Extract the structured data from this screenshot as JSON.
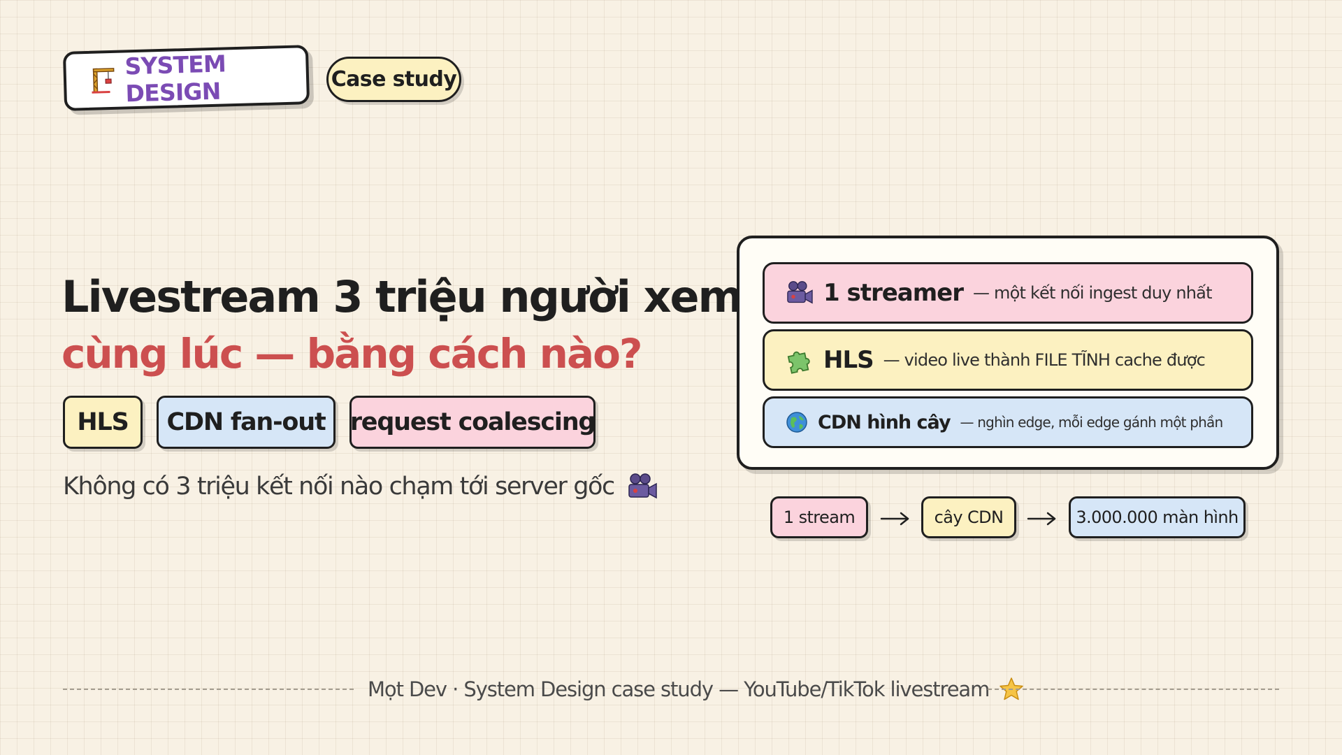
{
  "header": {
    "badge_label": "SYSTEM DESIGN",
    "badge_icon": "crane-icon",
    "case_label": "Case study"
  },
  "hero": {
    "title_line1": "Livestream 3 triệu người xem",
    "title_line2": "cùng lúc — bằng cách nào?",
    "tags": [
      "HLS",
      "CDN fan-out",
      "request coalescing"
    ],
    "subtitle": "Không có 3 triệu kết nối nào chạm tới server gốc",
    "subtitle_icon": "movie-camera-icon"
  },
  "panel": {
    "rows": [
      {
        "icon": "movie-camera-icon",
        "key": "1 streamer",
        "note": "— một kết nối ingest duy nhất"
      },
      {
        "icon": "puzzle-icon",
        "key": "HLS",
        "note": "— video live thành FILE TĨNH cache được"
      },
      {
        "icon": "globe-icon",
        "key": "CDN hình cây",
        "note": "— nghìn edge, mỗi edge gánh một phần"
      }
    ]
  },
  "flow": {
    "steps": [
      "1 stream",
      "cây CDN",
      "3.000.000 màn hình"
    ],
    "arrow_icon": "arrow-right-icon"
  },
  "footer": {
    "text": "Mọt Dev · System Design case study — YouTube/TikTok livestream",
    "icon": "star-icon"
  },
  "colors": {
    "background": "#f8f1e4",
    "title_accent": "#cc4f4f",
    "badge_purple": "#7b4bb4",
    "pink": "#fbd3dd",
    "yellow": "#fcf1c1",
    "blue": "#d6e6f7"
  }
}
